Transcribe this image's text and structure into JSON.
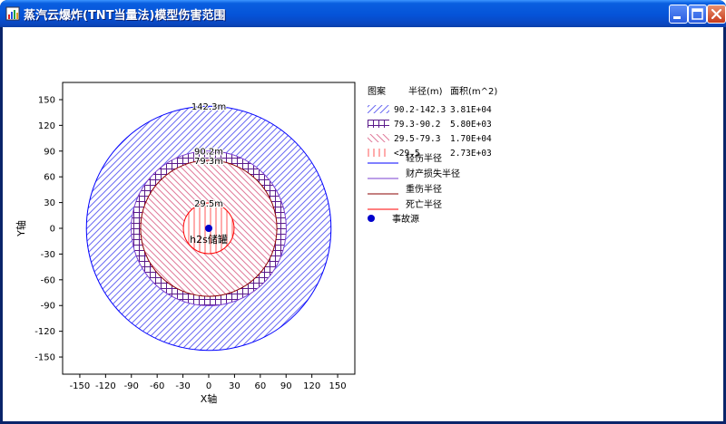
{
  "window": {
    "title": "蒸汽云爆炸(TNT当量法)模型伤害范围",
    "icon": "chart-app-icon",
    "controls": [
      "minimize-icon",
      "maximize-icon",
      "close-icon"
    ]
  },
  "chart_data": {
    "type": "scatter",
    "xlabel": "X轴",
    "ylabel": "Y轴",
    "xlim": [
      -170,
      170
    ],
    "ylim": [
      -170,
      170
    ],
    "xticks": [
      -150,
      -120,
      -90,
      -60,
      -30,
      0,
      30,
      60,
      90,
      120,
      150
    ],
    "yticks": [
      150,
      120,
      90,
      60,
      30,
      0,
      -30,
      -60,
      -90,
      -120,
      -150
    ],
    "grid": false,
    "legend_position": "right",
    "source": {
      "x": 0,
      "y": 0,
      "label": "h2s储罐",
      "color": "#0000cc"
    },
    "rings": [
      {
        "label": "142.3m",
        "radius": 142.3,
        "color": "#0000ff",
        "fill": "#6a6af2",
        "pattern": "diag-right"
      },
      {
        "label": "90.2m",
        "radius": 90.2,
        "color": "#7a3fd0",
        "fill": "#5a1a8a",
        "pattern": "grid"
      },
      {
        "label": "79.3m",
        "radius": 79.3,
        "color": "#8b0000",
        "fill": "#e07a9a",
        "pattern": "diag-left"
      },
      {
        "label": "29.5m",
        "radius": 29.5,
        "color": "#ff0000",
        "fill": "#ff5a5a",
        "pattern": "vertical"
      }
    ],
    "legend": {
      "headers": [
        "图案",
        "半径(m)",
        "面积(m^2)"
      ],
      "rows": [
        {
          "range": "90.2-142.3",
          "area": "3.81E+04",
          "pattern": "diag-right",
          "color": "#6a6af2"
        },
        {
          "range": "79.3-90.2",
          "area": "5.80E+03",
          "pattern": "grid",
          "color": "#5a1a8a"
        },
        {
          "range": "29.5-79.3",
          "area": "1.70E+04",
          "pattern": "diag-left",
          "color": "#e07a9a"
        },
        {
          "range": "<29.5",
          "area": "2.73E+03",
          "pattern": "vertical",
          "color": "#ff5a5a"
        }
      ],
      "lines": [
        {
          "name": "轻伤半径",
          "color": "#0000ff"
        },
        {
          "name": "财产损失半径",
          "color": "#7a3fd0"
        },
        {
          "name": "重伤半径",
          "color": "#8b0000"
        },
        {
          "name": "死亡半径",
          "color": "#ff0000"
        }
      ],
      "source_label": "事故源"
    }
  }
}
